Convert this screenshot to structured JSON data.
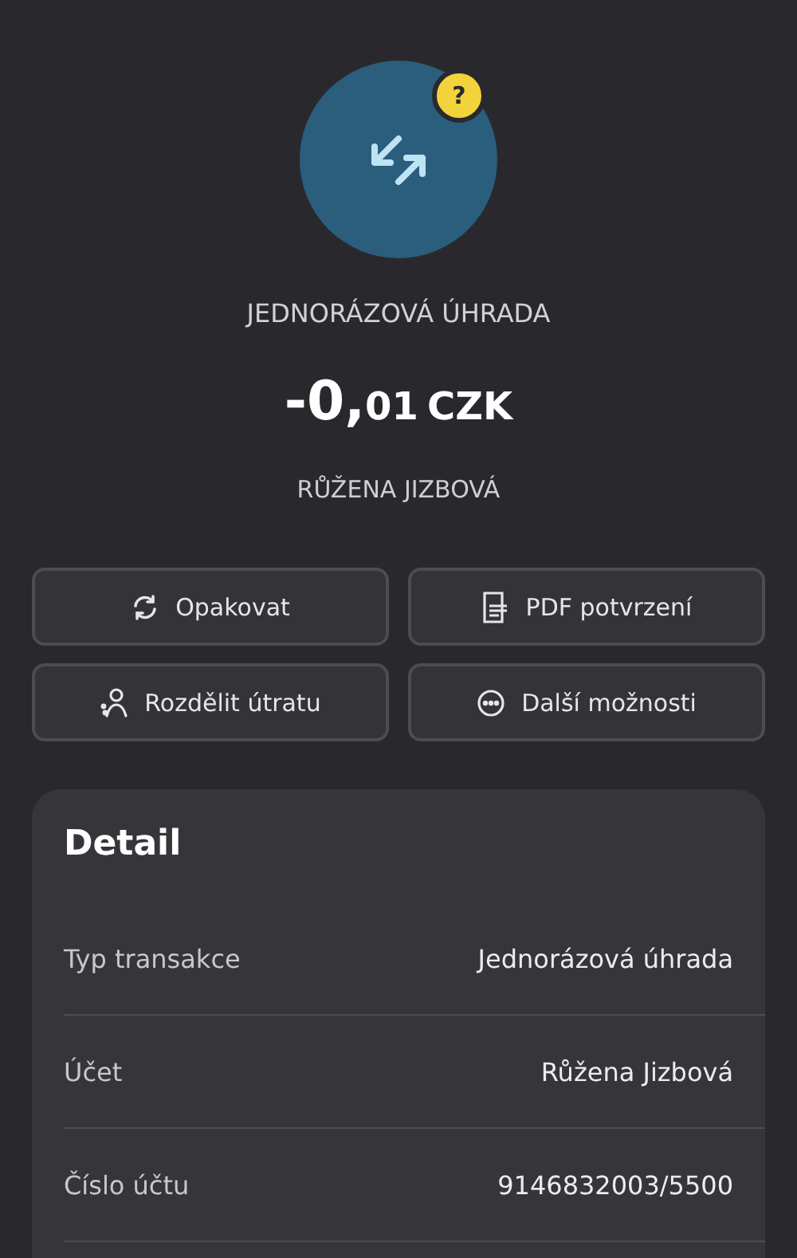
{
  "header": {
    "badge": "?",
    "type": "JEDNORÁZOVÁ ÚHRADA",
    "amount": {
      "whole": "-0,",
      "decimals": "01",
      "currency": "CZK"
    },
    "name": "RŮŽENA JIZBOVÁ"
  },
  "actions": [
    {
      "kind": "repeat",
      "label": "Opakovat"
    },
    {
      "kind": "pdf",
      "label": "PDF potvrzení"
    },
    {
      "kind": "split",
      "label": "Rozdělit útratu"
    },
    {
      "kind": "more",
      "label": "Další možnosti"
    }
  ],
  "detail": {
    "title": "Detail",
    "rows": [
      {
        "label": "Typ transakce",
        "value": "Jednorázová úhrada"
      },
      {
        "label": "Účet",
        "value": "Růžena Jizbová"
      },
      {
        "label": "Číslo účtu",
        "value": "9146832003/5500"
      }
    ]
  }
}
